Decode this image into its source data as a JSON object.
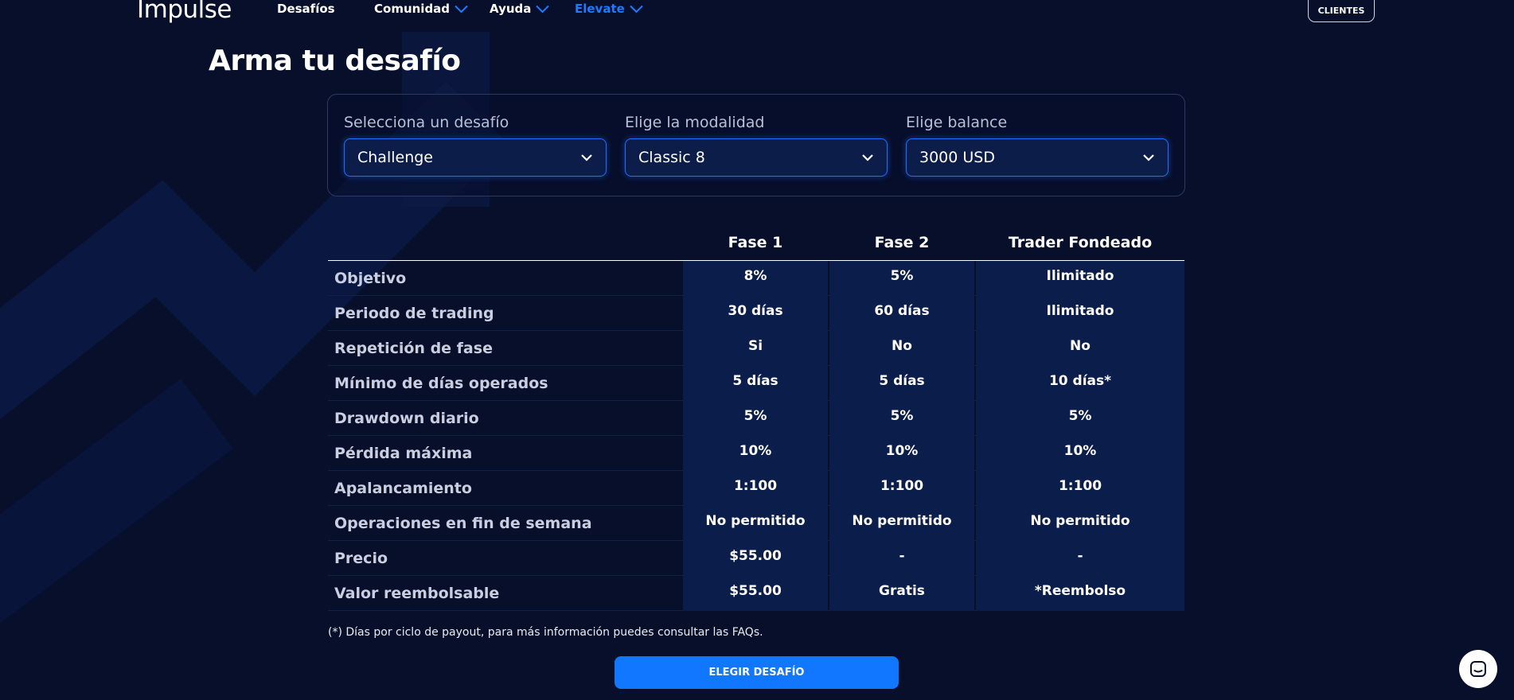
{
  "nav": {
    "logo": "Impulse",
    "items": [
      {
        "label": "Desafíos",
        "dropdown": false,
        "accent": false
      },
      {
        "label": "Comunidad",
        "dropdown": true,
        "accent": false
      },
      {
        "label": "Ayuda",
        "dropdown": true,
        "accent": false
      },
      {
        "label": "Elevate",
        "dropdown": true,
        "accent": true
      }
    ],
    "clients_label": "CLIENTES"
  },
  "page_title": "Arma tu desafío",
  "selectors": [
    {
      "label": "Selecciona un desafío",
      "value": "Challenge"
    },
    {
      "label": "Elige la modalidad",
      "value": "Classic 8"
    },
    {
      "label": "Elige balance",
      "value": "3000 USD"
    }
  ],
  "table": {
    "columns": [
      "Fase 1",
      "Fase 2",
      "Trader Fondeado"
    ],
    "rows": [
      {
        "label": "Objetivo",
        "values": [
          "8%",
          "5%",
          "Ilimitado"
        ]
      },
      {
        "label": "Periodo de trading",
        "values": [
          "30 días",
          "60 días",
          "Ilimitado"
        ]
      },
      {
        "label": "Repetición de fase",
        "values": [
          "Si",
          "No",
          "No"
        ]
      },
      {
        "label": "Mínimo de días operados",
        "values": [
          "5 días",
          "5 días",
          "10 días*"
        ]
      },
      {
        "label": "Drawdown diario",
        "values": [
          "5%",
          "5%",
          "5%"
        ]
      },
      {
        "label": "Pérdida máxima",
        "values": [
          "10%",
          "10%",
          "10%"
        ]
      },
      {
        "label": "Apalancamiento",
        "values": [
          "1:100",
          "1:100",
          "1:100"
        ]
      },
      {
        "label": "Operaciones en fin de semana",
        "values": [
          "No permitido",
          "No permitido",
          "No permitido"
        ]
      },
      {
        "label": "Precio",
        "values": [
          "$55.00",
          "-",
          "-"
        ]
      },
      {
        "label": "Valor reembolsable",
        "values": [
          "$55.00",
          "Gratis",
          "*Reembolso"
        ]
      }
    ]
  },
  "footnote": "(*) Días por ciclo de payout, para más información puedes consultar las FAQs.",
  "cta_label": "ELEGIR DESAFÍO",
  "icons": {
    "dropdown": "chevron-down-icon",
    "chat": "chat-icon"
  },
  "colors": {
    "background": "#070f2b",
    "accent": "#1277ff",
    "cell": "#0b1e4b"
  }
}
